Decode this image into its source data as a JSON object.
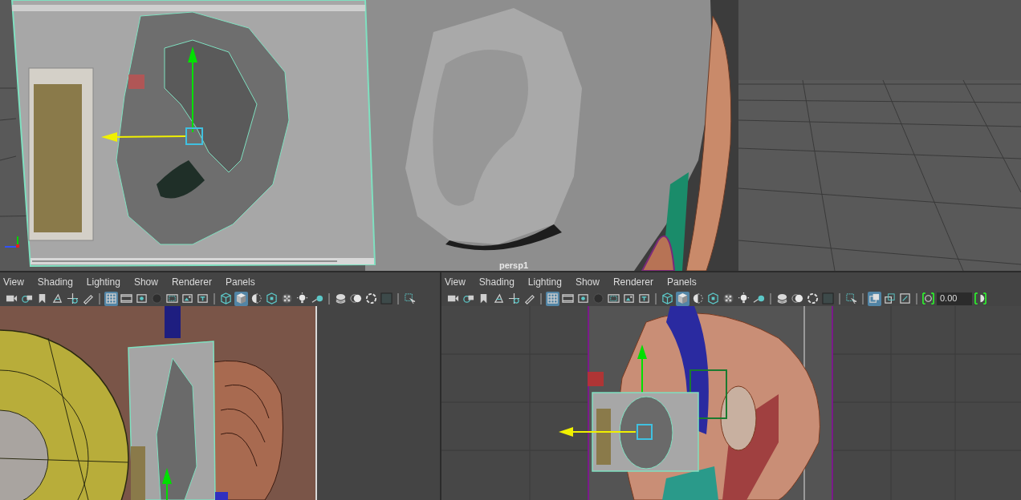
{
  "top_viewport": {
    "camera_label": "persp1"
  },
  "panels": [
    {
      "menu": [
        "View",
        "Shading",
        "Lighting",
        "Show",
        "Renderer",
        "Panels"
      ],
      "toolbar": [
        {
          "kind": "camera",
          "selected": false
        },
        {
          "kind": "cameragear",
          "selected": false
        },
        {
          "kind": "bookmark",
          "selected": false
        },
        {
          "kind": "imageplane",
          "selected": false
        },
        {
          "kind": "move",
          "selected": false
        },
        {
          "kind": "pencil",
          "selected": false
        },
        {
          "kind": "separator"
        },
        {
          "kind": "grid",
          "selected": true
        },
        {
          "kind": "film",
          "selected": false
        },
        {
          "kind": "gate",
          "selected": false
        },
        {
          "kind": "darkcircle",
          "selected": false
        },
        {
          "kind": "safe",
          "selected": false
        },
        {
          "kind": "picture",
          "selected": false
        },
        {
          "kind": "text",
          "selected": false
        },
        {
          "kind": "separator"
        },
        {
          "kind": "wirecube",
          "selected": false
        },
        {
          "kind": "shadedcube",
          "selected": true
        },
        {
          "kind": "halfcircle",
          "selected": false
        },
        {
          "kind": "texcube",
          "selected": false
        },
        {
          "kind": "checker",
          "selected": false
        },
        {
          "kind": "bulb",
          "selected": false
        },
        {
          "kind": "shadowball",
          "selected": false
        },
        {
          "kind": "separator"
        },
        {
          "kind": "ballstack",
          "selected": false
        },
        {
          "kind": "twoballs",
          "selected": false
        },
        {
          "kind": "dashring",
          "selected": false
        },
        {
          "kind": "darksquare",
          "selected": false
        },
        {
          "kind": "separator"
        },
        {
          "kind": "selectarrow",
          "selected": false
        }
      ]
    },
    {
      "menu": [
        "View",
        "Shading",
        "Lighting",
        "Show",
        "Renderer",
        "Panels"
      ],
      "toolbar": [
        {
          "kind": "camera",
          "selected": false
        },
        {
          "kind": "cameragear",
          "selected": false
        },
        {
          "kind": "bookmark",
          "selected": false
        },
        {
          "kind": "imageplane",
          "selected": false
        },
        {
          "kind": "move",
          "selected": false
        },
        {
          "kind": "pencil",
          "selected": false
        },
        {
          "kind": "separator"
        },
        {
          "kind": "grid",
          "selected": true
        },
        {
          "kind": "film",
          "selected": false
        },
        {
          "kind": "gate",
          "selected": false
        },
        {
          "kind": "darkcircle",
          "selected": false
        },
        {
          "kind": "safe",
          "selected": false
        },
        {
          "kind": "picture",
          "selected": false
        },
        {
          "kind": "text",
          "selected": false
        },
        {
          "kind": "separator"
        },
        {
          "kind": "wirecube",
          "selected": false
        },
        {
          "kind": "shadedcube",
          "selected": true
        },
        {
          "kind": "halfcircle",
          "selected": false
        },
        {
          "kind": "texcube",
          "selected": false
        },
        {
          "kind": "checker",
          "selected": false
        },
        {
          "kind": "bulb",
          "selected": false
        },
        {
          "kind": "shadowball",
          "selected": false
        },
        {
          "kind": "separator"
        },
        {
          "kind": "ballstack",
          "selected": false
        },
        {
          "kind": "twoballs",
          "selected": false
        },
        {
          "kind": "dashring",
          "selected": false
        },
        {
          "kind": "darksquare",
          "selected": false
        },
        {
          "kind": "separator"
        },
        {
          "kind": "selectarrow",
          "selected": false
        },
        {
          "kind": "separator"
        },
        {
          "kind": "isolate",
          "selected": true
        },
        {
          "kind": "overlay",
          "selected": false
        },
        {
          "kind": "framed",
          "selected": false
        },
        {
          "kind": "separator"
        },
        {
          "kind": "exposure",
          "selected": false
        },
        {
          "kind": "field",
          "value": "0.00"
        },
        {
          "kind": "gamma",
          "selected": false
        }
      ]
    }
  ]
}
